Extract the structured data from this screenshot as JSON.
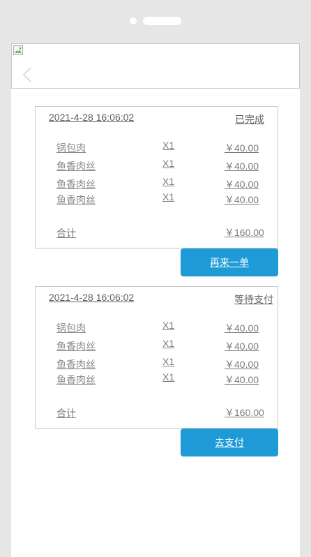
{
  "orders": [
    {
      "date": "2021-4-28 16:06:02",
      "status": "已完成",
      "items": [
        {
          "name": "锅包肉",
          "qty": "X1",
          "price": "￥40.00"
        },
        {
          "name": "鱼香肉丝",
          "qty": "X1",
          "price": "￥40.00"
        },
        {
          "name": "鱼香肉丝",
          "qty": "X1",
          "price": "￥40.00"
        },
        {
          "name": "鱼香肉丝",
          "qty": "X1",
          "price": "￥40.00"
        }
      ],
      "total_label": "合计",
      "total_value": "￥160.00",
      "action_label": "再来一单"
    },
    {
      "date": "2021-4-28 16:06:02",
      "status": "等待支付",
      "items": [
        {
          "name": "锅包肉",
          "qty": "X1",
          "price": "￥40.00"
        },
        {
          "name": "鱼香肉丝",
          "qty": "X1",
          "price": "￥40.00"
        },
        {
          "name": "鱼香肉丝",
          "qty": "X1",
          "price": "￥40.00"
        },
        {
          "name": "鱼香肉丝",
          "qty": "X1",
          "price": "￥40.00"
        }
      ],
      "total_label": "合计",
      "total_value": "￥160.00",
      "action_label": "去支付"
    }
  ],
  "icons": {
    "back": "chevron-left-icon",
    "header_image": "broken-image-icon"
  },
  "colors": {
    "accent": "#1e9bd7",
    "frame": "#e6e6e6",
    "border": "#c9c9c9",
    "text": "#7a7a7a"
  }
}
